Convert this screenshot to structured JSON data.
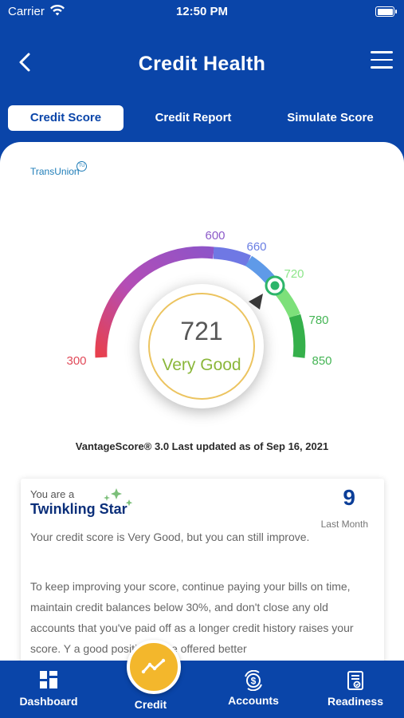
{
  "status": {
    "carrier": "Carrier",
    "time": "12:50 PM"
  },
  "header": {
    "title": "Credit Health"
  },
  "tabs": [
    {
      "label": "Credit Score",
      "active": true
    },
    {
      "label": "Credit Report",
      "active": false
    },
    {
      "label": "Simulate Score",
      "active": false
    }
  ],
  "bureau": {
    "logo_text": "TransUnion",
    "badge": "TU"
  },
  "gauge": {
    "min": 300,
    "max": 850,
    "ticks": [
      "300",
      "600",
      "660",
      "720",
      "780",
      "850"
    ],
    "score": "721",
    "rating": "Very Good"
  },
  "updated_text": "VantageScore® 3.0 Last updated as of Sep 16, 2021",
  "info": {
    "prefix": "You are a",
    "status_title": "Twinkling Star",
    "count": "9",
    "count_label": "Last Month",
    "para1": "Your credit score is Very Good, but you can still improve.",
    "para2": "To keep improving your score, continue paying your bills on time, maintain credit balances below 30%, and don't close any old accounts that you've paid off as a longer credit history raises your score. Y           a good position to be offered better"
  },
  "tabbar": [
    {
      "label": "Dashboard",
      "icon": "dashboard-icon"
    },
    {
      "label": "Credit",
      "icon": "credit-trend-icon"
    },
    {
      "label": "Accounts",
      "icon": "accounts-icon"
    },
    {
      "label": "Readiness",
      "icon": "readiness-icon"
    }
  ],
  "colors": {
    "brand": "#0a45a9",
    "accent": "#f3b72c",
    "good": "#8bb73b"
  }
}
